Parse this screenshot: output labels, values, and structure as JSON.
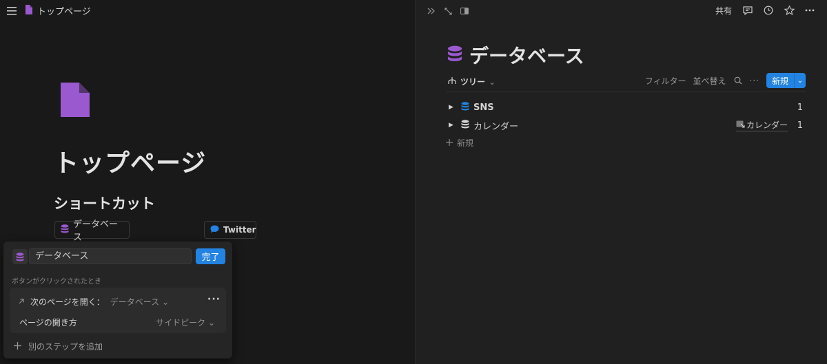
{
  "left": {
    "breadcrumb": {
      "page_label": "トップページ"
    },
    "page_title": "トップページ",
    "section_title": "ショートカット",
    "shortcuts": [
      {
        "label": "データベース",
        "icon": "database-icon"
      },
      {
        "label": "Twitter",
        "icon": "chat-bubble-icon"
      }
    ],
    "popup": {
      "input_value": "データベース",
      "done_label": "完了",
      "hint": "ボタンがクリックされたとき",
      "action_label": "次のページを開く：",
      "action_value": "データベース",
      "open_mode_label": "ページの開き方",
      "open_mode_value": "サイドピーク",
      "add_step_label": "別のステップを追加"
    }
  },
  "right": {
    "share_label": "共有",
    "db_title": "データベース",
    "view_tab": "ツリー",
    "toolbar": {
      "filter_label": "フィルター",
      "sort_label": "並べ替え",
      "new_label": "新規"
    },
    "rows": [
      {
        "label": "SNS",
        "count": "1",
        "icon_color": "#2383e2"
      },
      {
        "label": "カレンダー",
        "count": "1",
        "tag": "カレンダー",
        "icon_color": "#d4d4d4"
      }
    ],
    "new_row_label": "新規"
  },
  "colors": {
    "accent": "#2383e2",
    "purple": "#9b59d0"
  }
}
